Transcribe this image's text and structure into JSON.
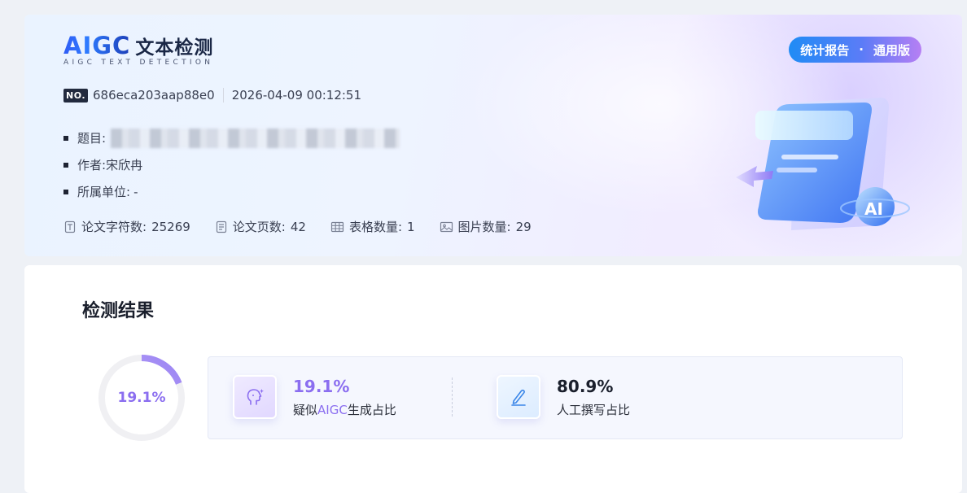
{
  "header": {
    "logo_brand": "AIGC",
    "logo_title": "文本检测",
    "logo_subtitle": "AIGC TEXT DETECTION",
    "badge_left": "统计报告",
    "badge_dot": "·",
    "badge_right": "通用版"
  },
  "report": {
    "no_tag": "NO.",
    "number": "686eca203aap88e0",
    "datetime": "2026-04-09 00:12:51"
  },
  "info": {
    "title_label": "题目:",
    "author_label": "作者:",
    "author_value": "宋欣冉",
    "org_label": "所属单位:",
    "org_value": "-"
  },
  "stats": {
    "chars_label": "论文字符数:",
    "chars_value": "25269",
    "pages_label": "论文页数:",
    "pages_value": "42",
    "tables_label": "表格数量:",
    "tables_value": "1",
    "images_label": "图片数量:",
    "images_value": "29"
  },
  "result": {
    "section_title": "检测结果",
    "ring_label": "19.1%",
    "ring_fraction": 0.191,
    "ai_value": "19.1%",
    "ai_label_pre": "疑似",
    "ai_label_hl": "AIGC",
    "ai_label_post": "生成占比",
    "human_value": "80.9%",
    "human_label": "人工撰写占比"
  },
  "colors": {
    "accent_purple": "#8b6ef0",
    "accent_blue": "#2f6bf5",
    "ring_track": "#f0f0f3"
  }
}
